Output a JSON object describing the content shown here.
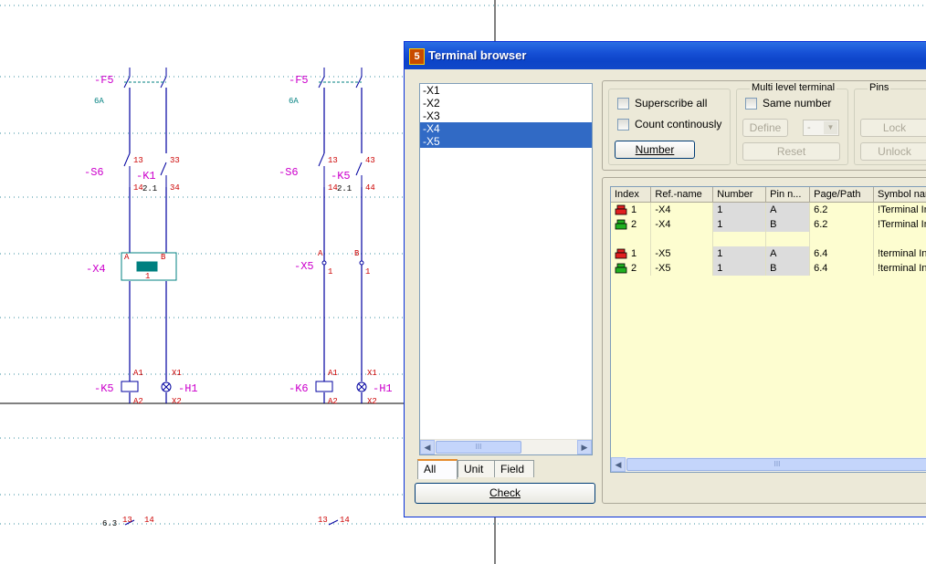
{
  "schematic": {
    "left_circuit": {
      "fuse_label": "-F5",
      "fuse_rating": "6A",
      "switch_label": "-S6",
      "relay_label": "-K1",
      "contact_13": "13",
      "contact_14": "14",
      "contact_33": "33",
      "contact_34": "34",
      "ref": "2.1",
      "terminal_label": "-X4",
      "term_a": "A",
      "term_b": "B",
      "term_1": "1",
      "coil_label": "-K5",
      "lamp_label": "-H1",
      "a1": "A1",
      "a2": "A2",
      "x1": "X1",
      "x2": "X2",
      "bottom_ref": "6.3",
      "bottom_13": "13",
      "bottom_14": "14"
    },
    "right_circuit": {
      "fuse_label": "-F5",
      "fuse_rating": "6A",
      "switch_label": "-S6",
      "relay_label": "-K5",
      "contact_13": "13",
      "contact_14": "14",
      "contact_43": "43",
      "contact_44": "44",
      "ref": "2.1",
      "terminal_label": "-X5",
      "term_a": "A",
      "term_b": "B",
      "term_1a": "1",
      "term_1b": "1",
      "coil_label": "-K6",
      "lamp_label": "-H1",
      "a1": "A1",
      "a2": "A2",
      "x1": "X1",
      "x2": "X2",
      "bottom_13": "13",
      "bottom_14": "14"
    }
  },
  "window": {
    "title": "Terminal browser",
    "icon_text": "5",
    "terminal_list": [
      "-X1",
      "-X2",
      "-X3",
      "-X4",
      "-X5"
    ],
    "selected_terminals": [
      "-X4",
      "-X5"
    ],
    "tabs": [
      "All",
      "Unit",
      "Field"
    ],
    "active_tab": "All",
    "check_button": "Check",
    "options": {
      "superscribe_all": "Superscribe all",
      "count_continously": "Count continously",
      "number_button": "Number"
    },
    "multi_level": {
      "title": "Multi level terminal",
      "same_number": "Same number",
      "define_button": "Define",
      "reset_button": "Reset",
      "level_value": "-"
    },
    "pins": {
      "title": "Pins",
      "lock_button": "Lock",
      "unlock_button": "Unlock"
    },
    "grid": {
      "columns": [
        "Index",
        "Ref.-name",
        "Number",
        "Pin n...",
        "Page/Path",
        "Symbol nar"
      ],
      "rows": [
        {
          "icon": "red-terminal-icon",
          "index": "1",
          "ref": "-X4",
          "number": "1",
          "pin": "A",
          "page": "6.2",
          "symbol": "!Terminal In"
        },
        {
          "icon": "green-terminal-icon",
          "index": "2",
          "ref": "-X4",
          "number": "1",
          "pin": "B",
          "page": "6.2",
          "symbol": "!Terminal In"
        },
        {
          "icon": "",
          "index": "",
          "ref": "",
          "number": "",
          "pin": "",
          "page": "",
          "symbol": ""
        },
        {
          "icon": "red-terminal-icon",
          "index": "1",
          "ref": "-X5",
          "number": "1",
          "pin": "A",
          "page": "6.4",
          "symbol": "!terminal Ins"
        },
        {
          "icon": "green-terminal-icon",
          "index": "2",
          "ref": "-X5",
          "number": "1",
          "pin": "B",
          "page": "6.4",
          "symbol": "!terminal Ins"
        }
      ]
    }
  },
  "colors": {
    "wire": "#0000a0",
    "label_magenta": "#cc00cc",
    "label_red": "#cc0000",
    "teal": "#008080",
    "grid_dots": "#3a8fa0",
    "selection": "#316ac5"
  }
}
